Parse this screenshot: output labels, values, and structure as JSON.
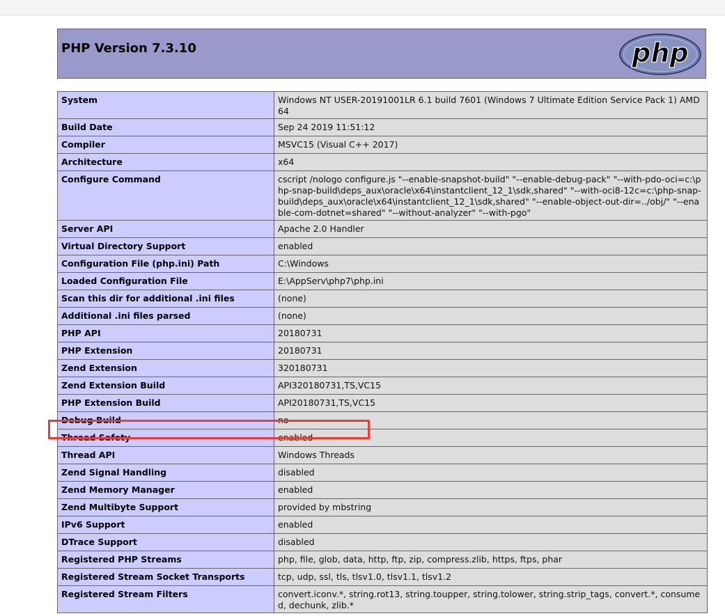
{
  "header": {
    "title": "PHP Version 7.3.10",
    "logo_text": "php"
  },
  "colors": {
    "header_bg": "#9999cc",
    "key_bg": "#ccccff",
    "value_bg": "#dddddd",
    "highlight": "#f03a3a"
  },
  "rows": [
    {
      "key": "System",
      "value": "Windows NT USER-20191001LR 6.1 build 7601 (Windows 7 Ultimate Edition Service Pack 1) AMD64"
    },
    {
      "key": "Build Date",
      "value": "Sep 24 2019 11:51:12"
    },
    {
      "key": "Compiler",
      "value": "MSVC15 (Visual C++ 2017)"
    },
    {
      "key": "Architecture",
      "value": "x64"
    },
    {
      "key": "Configure Command",
      "value": "cscript /nologo configure.js \"--enable-snapshot-build\" \"--enable-debug-pack\" \"--with-pdo-oci=c:\\php-snap-build\\deps_aux\\oracle\\x64\\instantclient_12_1\\sdk,shared\" \"--with-oci8-12c=c:\\php-snap-build\\deps_aux\\oracle\\x64\\instantclient_12_1\\sdk,shared\" \"--enable-object-out-dir=../obj/\" \"--enable-com-dotnet=shared\" \"--without-analyzer\" \"--with-pgo\""
    },
    {
      "key": "Server API",
      "value": "Apache 2.0 Handler"
    },
    {
      "key": "Virtual Directory Support",
      "value": "enabled"
    },
    {
      "key": "Configuration File (php.ini) Path",
      "value": "C:\\Windows"
    },
    {
      "key": "Loaded Configuration File",
      "value": "E:\\AppServ\\php7\\php.ini"
    },
    {
      "key": "Scan this dir for additional .ini files",
      "value": "(none)"
    },
    {
      "key": "Additional .ini files parsed",
      "value": "(none)"
    },
    {
      "key": "PHP API",
      "value": "20180731"
    },
    {
      "key": "PHP Extension",
      "value": "20180731"
    },
    {
      "key": "Zend Extension",
      "value": "320180731"
    },
    {
      "key": "Zend Extension Build",
      "value": "API320180731,TS,VC15"
    },
    {
      "key": "PHP Extension Build",
      "value": "API20180731,TS,VC15"
    },
    {
      "key": "Debug Build",
      "value": "no"
    },
    {
      "key": "Thread Safety",
      "value": "enabled"
    },
    {
      "key": "Thread API",
      "value": "Windows Threads"
    },
    {
      "key": "Zend Signal Handling",
      "value": "disabled"
    },
    {
      "key": "Zend Memory Manager",
      "value": "enabled"
    },
    {
      "key": "Zend Multibyte Support",
      "value": "provided by mbstring"
    },
    {
      "key": "IPv6 Support",
      "value": "enabled"
    },
    {
      "key": "DTrace Support",
      "value": "disabled"
    },
    {
      "key": "Registered PHP Streams",
      "value": "php, file, glob, data, http, ftp, zip, compress.zlib, https, ftps, phar"
    },
    {
      "key": "Registered Stream Socket Transports",
      "value": "tcp, udp, ssl, tls, tlsv1.0, tlsv1.1, tlsv1.2"
    },
    {
      "key": "Registered Stream Filters",
      "value": "convert.iconv.*, string.rot13, string.toupper, string.tolower, string.strip_tags, convert.*, consumed, dechunk, zlib.*"
    }
  ]
}
